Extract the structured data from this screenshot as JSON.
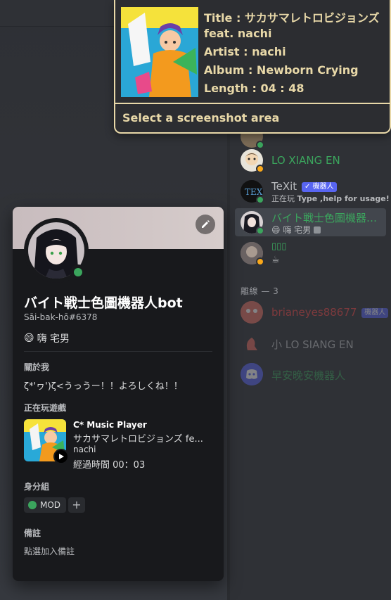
{
  "tooltip": {
    "title_line1": "Title : サカサマレトロビジョンズ",
    "title_line2": "feat. nachi",
    "artist": "Artist : nachi",
    "album": "Album : Newborn Crying",
    "length": "Length : 04 : 48",
    "action": "Select a screenshot area"
  },
  "members": {
    "online": [
      {
        "name": "LO XIANG EN",
        "name_color": "#3ba55d",
        "status": "idle"
      },
      {
        "name": "TeXit",
        "name_color": "#b9bbbe",
        "bot_tag": "✓ 機器人",
        "sub_prefix": "正在玩 ",
        "sub": "Type ,help for usage!",
        "status": "online"
      },
      {
        "name": "バイト戦士色圖機器…",
        "name_color": "#3ba55d",
        "sub": "嗨 宅男",
        "status": "online",
        "selected": true
      },
      {
        "name": "▯▯▯",
        "name_color": "#3ba55d",
        "sub": "☕",
        "status": "idle"
      }
    ],
    "offline_header": "離線 — 3",
    "offline": [
      {
        "name": "brianeyes88677",
        "name_color": "#f04747",
        "bot_tag": "機器人"
      },
      {
        "name": "小 LO SIANG EN",
        "name_color": "#b9bbbe"
      },
      {
        "name": "早安晚安機器人",
        "name_color": "#3ba55d"
      }
    ]
  },
  "profile": {
    "username": "バイト戦士色圖機器人bot",
    "tag": "Sāi-bak-hō#6378",
    "custom_status": "嗨 宅男",
    "about_title": "關於我",
    "about_text": "ζ*'ヮ')ζ<うっうー！！よろしくね！！",
    "playing_title": "正在玩遊戲",
    "game_name": "C* Music Player",
    "game_details": "サカサマレトロビジョンズ fe...",
    "game_state": "nachi",
    "elapsed": "經過時間 00：03",
    "roles_title": "身分組",
    "role": "MOD",
    "role_color": "#3ba55d",
    "note_title": "備註",
    "note_placeholder": "點選加入備註"
  }
}
